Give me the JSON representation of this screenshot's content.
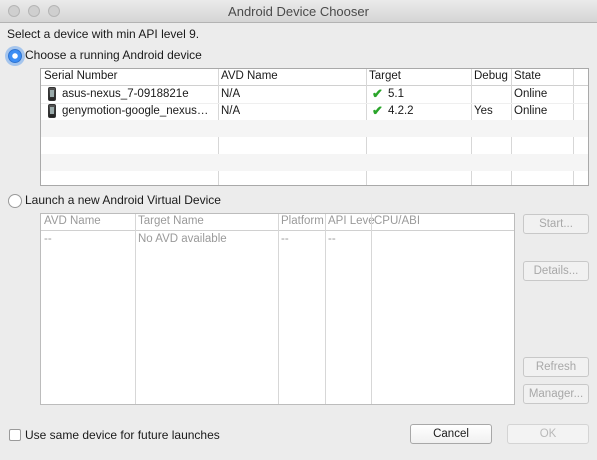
{
  "window": {
    "title": "Android Device Chooser"
  },
  "prompt": "Select a device with min API level 9.",
  "running": {
    "label": "Choose a running Android device",
    "selected": true,
    "columns": [
      "Serial Number",
      "AVD Name",
      "Target",
      "Debug",
      "State"
    ],
    "rows": [
      {
        "serial": "asus-nexus_7-0918821e",
        "avd": "N/A",
        "target": "5.1",
        "debug": "",
        "state": "Online"
      },
      {
        "serial": "genymotion-google_nexus…",
        "avd": "N/A",
        "target": "4.2.2",
        "debug": "Yes",
        "state": "Online"
      }
    ]
  },
  "launch": {
    "label": "Launch a new Android Virtual Device",
    "selected": false,
    "columns": [
      "AVD Name",
      "Target Name",
      "Platform",
      "API Leve",
      "CPU/ABI"
    ],
    "row": {
      "avd": "--",
      "target": "No AVD available",
      "platform": "--",
      "api": "--"
    },
    "buttons": {
      "start": "Start...",
      "details": "Details...",
      "refresh": "Refresh",
      "manager": "Manager..."
    }
  },
  "footer": {
    "same_device_label": "Use same device for future launches",
    "same_device_checked": false,
    "cancel": "Cancel",
    "ok": "OK"
  },
  "icons": {
    "device": "phone-icon",
    "target_ok": "checkmark-icon"
  }
}
